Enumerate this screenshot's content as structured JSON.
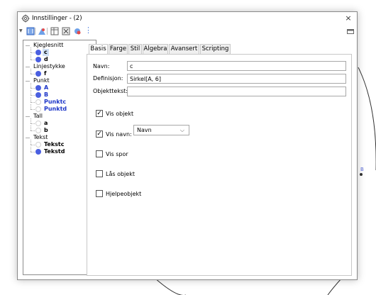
{
  "window": {
    "title": "Innstillinger - (2)",
    "close_glyph": "×"
  },
  "toolbar": {
    "icons": [
      "menu-triangle-icon",
      "graphics-view-icon",
      "algebra-icon",
      "table-icon",
      "probability-icon",
      "spreadsheet-icon",
      "more-dots-icon",
      "dock-icon"
    ],
    "more_glyph": "⋮",
    "menu_glyph": "▼"
  },
  "tree": {
    "items": [
      {
        "label": "Kjeglesnitt",
        "kind": "group"
      },
      {
        "label": "c",
        "kind": "child",
        "marker": "filled",
        "bold": true,
        "blue": false,
        "selected": true
      },
      {
        "label": "d",
        "kind": "child",
        "marker": "filled",
        "bold": true,
        "blue": false
      },
      {
        "label": "Linjestykke",
        "kind": "group"
      },
      {
        "label": "f",
        "kind": "child",
        "marker": "filled",
        "bold": true,
        "blue": false
      },
      {
        "label": "Punkt",
        "kind": "group"
      },
      {
        "label": "A",
        "kind": "child",
        "marker": "filled",
        "bold": true,
        "blue": true
      },
      {
        "label": "B",
        "kind": "child",
        "marker": "filled",
        "bold": true,
        "blue": true
      },
      {
        "label": "Punktc",
        "kind": "child",
        "marker": "empty",
        "bold": true,
        "blue": true
      },
      {
        "label": "Punktd",
        "kind": "child",
        "marker": "empty",
        "bold": true,
        "blue": true
      },
      {
        "label": "Tall",
        "kind": "group"
      },
      {
        "label": "a",
        "kind": "child",
        "marker": "empty",
        "bold": true,
        "blue": false
      },
      {
        "label": "b",
        "kind": "child",
        "marker": "empty",
        "bold": true,
        "blue": false
      },
      {
        "label": "Tekst",
        "kind": "group"
      },
      {
        "label": "Tekstc",
        "kind": "child",
        "marker": "empty",
        "bold": true,
        "blue": false
      },
      {
        "label": "Tekstd",
        "kind": "child",
        "marker": "filled",
        "bold": true,
        "blue": false
      }
    ]
  },
  "tabs": [
    "Basis",
    "Farge",
    "Stil",
    "Algebra",
    "Avansert",
    "Scripting"
  ],
  "active_tab": "Basis",
  "basis": {
    "navn_label": "Navn:",
    "navn_value": "c",
    "definisjon_label": "Definisjon:",
    "definisjon_value": "Sirkel[A, 6]",
    "objekttekst_label": "Objekttekst:",
    "objekttekst_value": "",
    "vis_objekt_label": "Vis objekt",
    "vis_objekt_checked": true,
    "vis_navn_label": "Vis navn:",
    "vis_navn_checked": true,
    "vis_navn_option": "Navn",
    "vis_spor_label": "Vis spor",
    "vis_spor_checked": false,
    "laas_objekt_label": "Lås objekt",
    "laas_objekt_checked": false,
    "hjelpeobjekt_label": "Hjelpeobjekt",
    "hjelpeobjekt_checked": false,
    "check_glyph": "✓",
    "chevron_glyph": "⌵"
  },
  "canvas": {
    "point_label": "B"
  },
  "colors": {
    "point_blue": "#4a5fe0",
    "label_blue": "#1c35c8",
    "selection": "#cfe0f5"
  }
}
